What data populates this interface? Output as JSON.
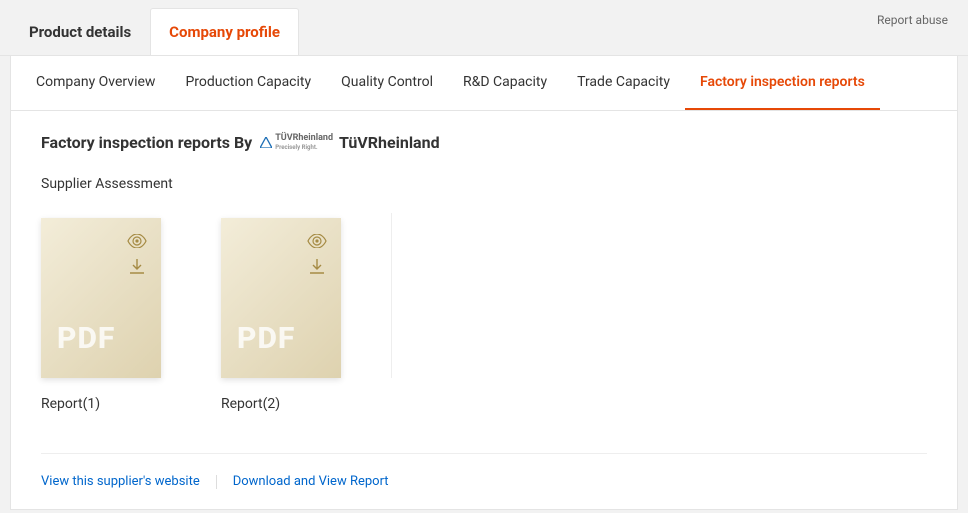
{
  "header": {
    "tabs": [
      {
        "label": "Product details"
      },
      {
        "label": "Company profile"
      }
    ],
    "active_tab_index": 1,
    "report_abuse": "Report abuse"
  },
  "subnav": {
    "tabs": [
      {
        "label": "Company Overview"
      },
      {
        "label": "Production Capacity"
      },
      {
        "label": "Quality Control"
      },
      {
        "label": "R&D Capacity"
      },
      {
        "label": "Trade Capacity"
      },
      {
        "label": "Factory inspection reports"
      }
    ],
    "active_tab_index": 5
  },
  "content": {
    "title_prefix": "Factory inspection reports By",
    "certifier_logo_text": "TÜVRheinland",
    "certifier_tagline": "Precisely Right.",
    "certifier_name": "TüVRheinland",
    "sub_heading": "Supplier Assessment",
    "pdf_text": "PDF",
    "reports": [
      {
        "name": "Report(1)"
      },
      {
        "name": "Report(2)"
      }
    ]
  },
  "footer": {
    "link_website": "View this supplier's website",
    "link_report": "Download and View Report"
  },
  "colors": {
    "accent": "#e64807",
    "link": "#0066cc"
  }
}
